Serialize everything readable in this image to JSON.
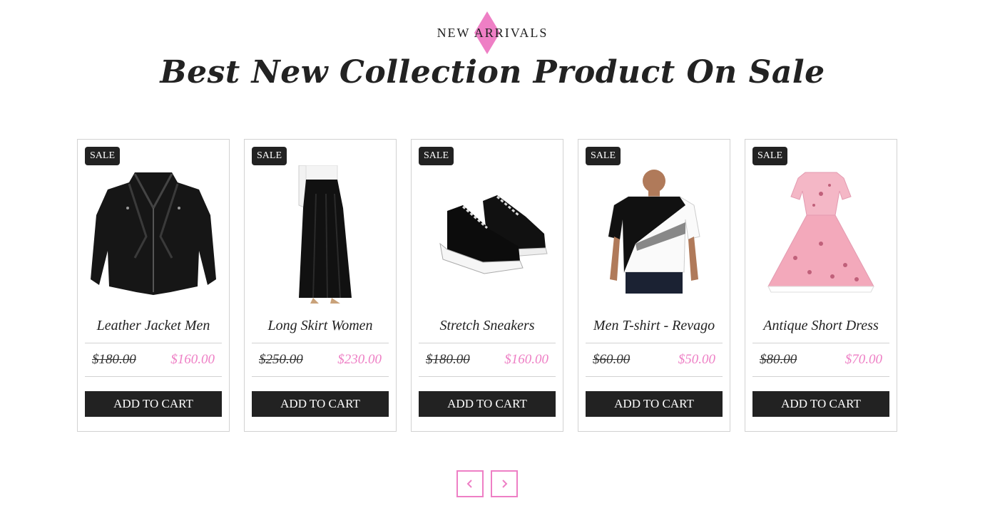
{
  "section": {
    "eyebrow": "NEW ARRIVALS",
    "headline": "Best New Collection Product On Sale",
    "accent_color": "#ee7fc5"
  },
  "products": [
    {
      "badge": "SALE",
      "name": "Leather Jacket Men",
      "old_price": "$180.00",
      "new_price": "$160.00",
      "button": "ADD TO CART",
      "image": "leather-jacket"
    },
    {
      "badge": "SALE",
      "name": "Long Skirt Women",
      "old_price": "$250.00",
      "new_price": "$230.00",
      "button": "ADD TO CART",
      "image": "long-skirt"
    },
    {
      "badge": "SALE",
      "name": "Stretch Sneakers",
      "old_price": "$180.00",
      "new_price": "$160.00",
      "button": "ADD TO CART",
      "image": "sneakers"
    },
    {
      "badge": "SALE",
      "name": "Men T-shirt - Revago",
      "old_price": "$60.00",
      "new_price": "$50.00",
      "button": "ADD TO CART",
      "image": "t-shirt"
    },
    {
      "badge": "SALE",
      "name": "Antique Short Dress",
      "old_price": "$80.00",
      "new_price": "$70.00",
      "button": "ADD TO CART",
      "image": "dress"
    }
  ],
  "carousel": {
    "prev_icon": "chevron-left-icon",
    "next_icon": "chevron-right-icon"
  }
}
